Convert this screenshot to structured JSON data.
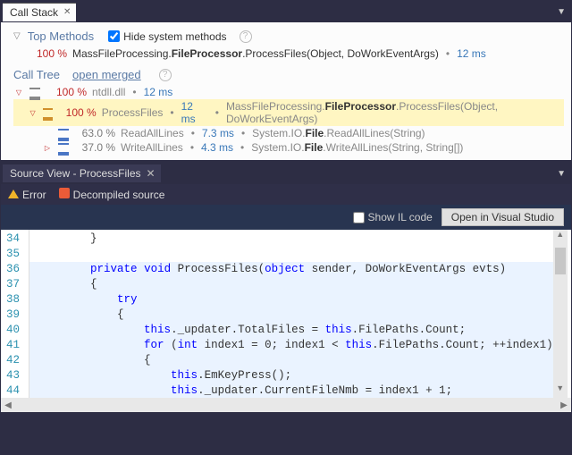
{
  "callStack": {
    "tabLabel": "Call Stack",
    "topMethods": {
      "title": "Top Methods",
      "hideSystemLabel": "Hide system methods",
      "row": {
        "percent": "100 %",
        "sigPrefix": "MassFileProcessing.",
        "sigBoldClass": "FileProcessor",
        "sigMid": ".ProcessFiles(Object, DoWorkEventArgs)",
        "time": "12 ms"
      }
    },
    "callTree": {
      "title": "Call Tree",
      "openMergedLabel": "open merged",
      "rows": [
        {
          "level": 0,
          "tri": "open-red",
          "icon": "gray",
          "pctClass": "pct-red",
          "percent": "100 %",
          "name": "ntdll.dll",
          "time": "12 ms",
          "sig": "",
          "hl": false
        },
        {
          "level": 1,
          "tri": "open-red",
          "icon": "orange",
          "pctClass": "pct-red",
          "percent": "100 %",
          "name": "ProcessFiles",
          "time": "12 ms",
          "sig": "MassFileProcessing.|FileProcessor|.ProcessFiles(Object, DoWorkEventArgs)",
          "hl": true
        },
        {
          "level": 2,
          "tri": "none",
          "icon": "blue",
          "pctClass": "pct-gray",
          "percent": "63.0 %",
          "name": "ReadAllLines",
          "time": "7.3 ms",
          "sig": "System.IO.|File|.ReadAllLines(String)",
          "hl": false
        },
        {
          "level": 2,
          "tri": "closed-red",
          "icon": "blue",
          "pctClass": "pct-gray",
          "percent": "37.0 %",
          "name": "WriteAllLines",
          "time": "4.3 ms",
          "sig": "System.IO.|File|.WriteAllLines(String, String[])",
          "hl": false
        }
      ]
    }
  },
  "sourceView": {
    "tabLabel": "Source View - ProcessFiles",
    "errorLabel": "Error",
    "decompLabel": "Decompiled source",
    "showILLabel": "Show IL code",
    "openVSLabel": "Open in Visual Studio",
    "startLine": 34,
    "lines": [
      {
        "hl": false,
        "txt": "        }"
      },
      {
        "hl": false,
        "txt": ""
      },
      {
        "hl": true,
        "txt": "        private void ProcessFiles(object sender, DoWorkEventArgs evts)"
      },
      {
        "hl": true,
        "txt": "        {"
      },
      {
        "hl": true,
        "txt": "            try"
      },
      {
        "hl": true,
        "txt": "            {"
      },
      {
        "hl": true,
        "txt": "                this._updater.TotalFiles = this.FilePaths.Count;"
      },
      {
        "hl": true,
        "txt": "                for (int index1 = 0; index1 < this.FilePaths.Count; ++index1)"
      },
      {
        "hl": true,
        "txt": "                {"
      },
      {
        "hl": true,
        "txt": "                    this.EmKeyPress();"
      },
      {
        "hl": true,
        "txt": "                    this._updater.CurrentFileNmb = index1 + 1;"
      }
    ],
    "keywords": [
      "private",
      "void",
      "object",
      "try",
      "this",
      "for",
      "int"
    ]
  }
}
